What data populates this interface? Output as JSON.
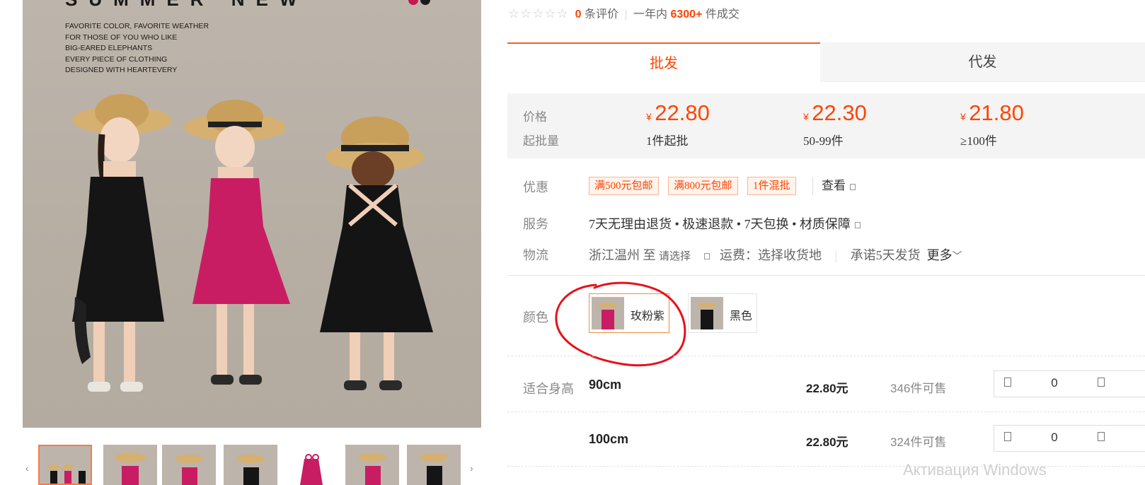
{
  "banner": {
    "title": "SUMMER NEW",
    "lines": [
      "FAVORITE COLOR, FAVORITE WEATHER",
      "FOR THOSE OF YOU WHO LIKE",
      "BIG-EARED ELEPHANTS",
      "EVERY PIECE OF CLOTHING",
      "DESIGNED WITH HEARTEVERY"
    ]
  },
  "rating": {
    "count": "0",
    "count_suffix": "条评价",
    "year_prefix": "一年内",
    "deals": "6300+",
    "deals_suffix": "件成交"
  },
  "tabs": {
    "wholesale": "批发",
    "dropship": "代发"
  },
  "price_box": {
    "price_label": "价格",
    "moq_label": "起批量",
    "currency": "¥",
    "tiers": [
      {
        "price": "22.80",
        "moq": "1件起批"
      },
      {
        "price": "22.30",
        "moq": "50-99件"
      },
      {
        "price": "21.80",
        "moq": "≥100件"
      }
    ]
  },
  "promo": {
    "label": "优惠",
    "tags": [
      "满500元包邮",
      "满800元包邮",
      "1件混批"
    ],
    "view": "查看"
  },
  "service": {
    "label": "服务",
    "text": "7天无理由退货 • 极速退款 • 7天包换 • 材质保障"
  },
  "logistics": {
    "label": "物流",
    "origin": "浙江温州",
    "to": "至",
    "select": "请选择",
    "fee": "运费：选择收货地",
    "promise": "承诺5天发货",
    "more": "更多"
  },
  "colors": {
    "label": "颜色",
    "options": [
      "玫粉紫",
      "黑色"
    ]
  },
  "sizes": {
    "label": "适合身高",
    "rows": [
      {
        "size": "90cm",
        "price": "22.80元",
        "stock": "346件可售",
        "qty": "0"
      },
      {
        "size": "100cm",
        "price": "22.80元",
        "stock": "324件可售",
        "qty": "0"
      }
    ]
  },
  "watermark": "Активация Windows",
  "colors_theme": {
    "accent": "#ff4400",
    "annotation": "#e8101a",
    "pink_dress": "#d11f6a"
  }
}
